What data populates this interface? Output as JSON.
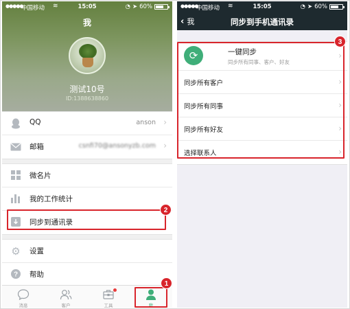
{
  "left": {
    "status": {
      "carrier": "中国移动",
      "time": "15:05",
      "battery": "60%"
    },
    "header": {
      "title": "我"
    },
    "profile": {
      "name": "测试10号",
      "id_text": "ID:1388638860"
    },
    "rows_account": [
      {
        "label": "QQ",
        "value": "anson",
        "icon": "qq-icon"
      },
      {
        "label": "邮箱",
        "value": "csnfi70@ansonyzb.com",
        "icon": "mail-icon"
      }
    ],
    "rows_tools": [
      {
        "label": "微名片",
        "icon": "card-icon"
      },
      {
        "label": "我的工作统计",
        "icon": "bar-chart-icon"
      },
      {
        "label": "同步到通讯录",
        "icon": "download-icon"
      }
    ],
    "rows_settings": [
      {
        "label": "设置",
        "icon": "gear-icon"
      },
      {
        "label": "帮助",
        "icon": "help-icon"
      }
    ],
    "tabs": [
      {
        "label": "消息",
        "icon": "chat-icon"
      },
      {
        "label": "客户",
        "icon": "contacts-icon"
      },
      {
        "label": "工具",
        "icon": "toolbox-icon"
      },
      {
        "label": "我",
        "icon": "person-icon"
      }
    ]
  },
  "right": {
    "status": {
      "carrier": "中国移动",
      "time": "15:05",
      "battery": "60%"
    },
    "nav": {
      "back_label": "我",
      "title": "同步到手机通讯录"
    },
    "sync_main": {
      "title": "一键同步",
      "subtitle": "同步所有同事、客户、好友"
    },
    "rows": [
      {
        "label": "同步所有客户"
      },
      {
        "label": "同步所有同事"
      },
      {
        "label": "同步所有好友"
      },
      {
        "label": "选择联系人"
      }
    ]
  },
  "annotations": [
    "1",
    "2",
    "3"
  ],
  "colors": {
    "accent": "#3fae79",
    "callout": "#d8242b",
    "navbar": "#1e2a2f"
  }
}
